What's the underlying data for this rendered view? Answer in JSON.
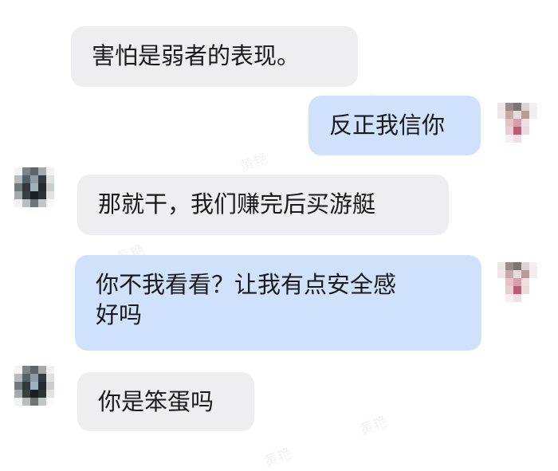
{
  "messages": [
    {
      "side": "in",
      "text": "害怕是弱者的表现。"
    },
    {
      "side": "out",
      "text": "反正我信你"
    },
    {
      "side": "in",
      "text": "那就干，我们赚完后买游艇"
    },
    {
      "side": "out",
      "line1": "你不我看看？让我有点安全感",
      "line2": "好吗"
    },
    {
      "side": "in",
      "text": "你是笨蛋吗"
    }
  ],
  "watermark": "黄艳",
  "colors": {
    "incoming_bubble": "#eeeef1",
    "outgoing_bubble": "#cfe1fb",
    "text": "#1a1a1a"
  },
  "avatars": {
    "self": [
      "#eee6e6",
      "#9a8c8c",
      "#7d7373",
      "#ddd3d3",
      "#f3efef",
      "#f0e8e8",
      "#c4a9a9",
      "#e8dada",
      "#b89b9b",
      "#f3eded",
      "#ffffff",
      "#e4c3c8",
      "#d69fab",
      "#f0dfe2",
      "#ffffff",
      "#ffffff",
      "#e7cfd3",
      "#b85d74",
      "#ecd9de",
      "#ffffff",
      "#ffffff",
      "#f6eef0",
      "#eedfe3",
      "#ffffff",
      "#ffffff"
    ],
    "contact": [
      "#f4f4f4",
      "#7d8585",
      "#5e6566",
      "#a6aaaa",
      "#f1f1f1",
      "#b7bbbb",
      "#55606a",
      "#8e9aa5",
      "#343b40",
      "#dfe1e1",
      "#6f7b7f",
      "#30383c",
      "#9fb1bf",
      "#24292c",
      "#c9cdcd",
      "#a5a9a9",
      "#384040",
      "#1b1f20",
      "#2d3333",
      "#e2e2e2",
      "#f2f2f2",
      "#b9bebf",
      "#6e7777",
      "#c3c6c6",
      "#fafafa"
    ]
  }
}
